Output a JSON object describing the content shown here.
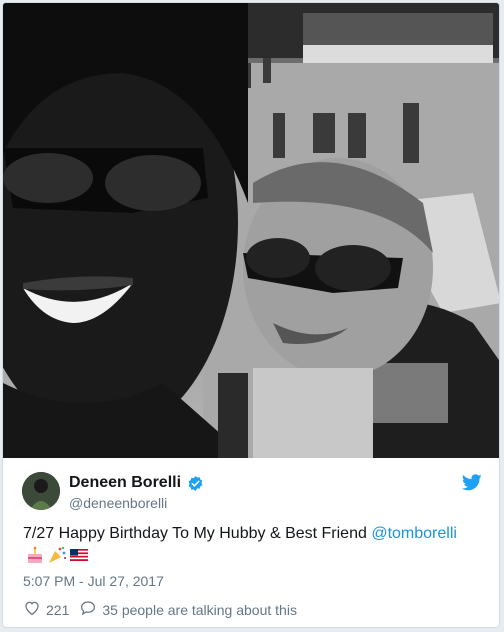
{
  "tweet": {
    "display_name": "Deneen Borelli",
    "handle": "@deneenborelli",
    "text_before_mention": "7/27 Happy Birthday To My Hubby & Best Friend ",
    "mention": "@tomborelli",
    "timestamp": "5:07 PM - Jul 27, 2017",
    "likes": "221",
    "conversation": "35 people are talking about this",
    "emojis": [
      "birthday-cake",
      "party-popper",
      "us-flag"
    ]
  },
  "colors": {
    "link": "#1b95e0",
    "twitter_blue": "#1da1f2",
    "secondary_text": "#657786",
    "primary_text": "#14171a"
  },
  "icons": [
    "verified-icon",
    "twitter-bird-icon",
    "heart-icon",
    "speech-bubble-icon"
  ]
}
